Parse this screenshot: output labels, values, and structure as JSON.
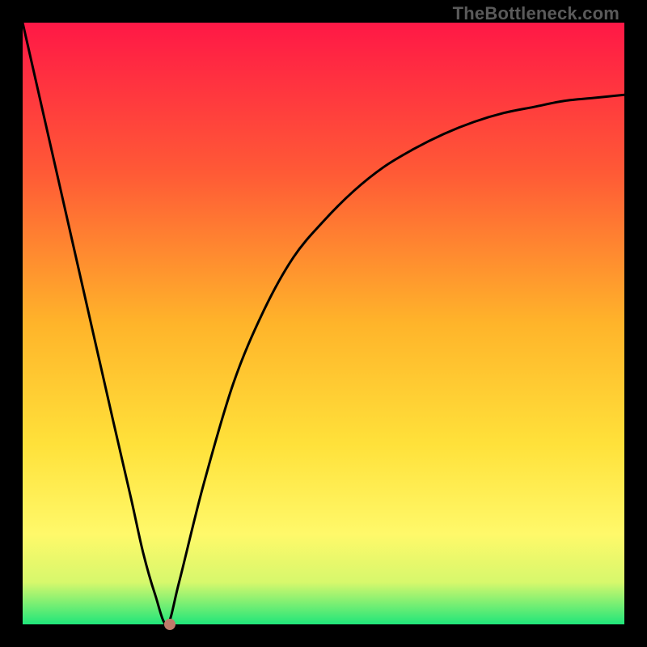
{
  "attribution": "TheBottleneck.com",
  "chart_data": {
    "type": "line",
    "title": "",
    "xlabel": "",
    "ylabel": "",
    "xlim": [
      0,
      100
    ],
    "ylim": [
      0,
      100
    ],
    "curve": {
      "name": "bottleneck-curve",
      "x": [
        0,
        5,
        10,
        15,
        18,
        20,
        22,
        24,
        26,
        30,
        35,
        40,
        45,
        50,
        55,
        60,
        65,
        70,
        75,
        80,
        85,
        90,
        95,
        100
      ],
      "y": [
        100,
        78,
        56,
        34,
        21,
        12,
        5,
        0,
        7,
        23,
        40,
        52,
        61,
        67,
        72,
        76,
        79,
        81.5,
        83.5,
        85,
        86,
        87,
        87.5,
        88
      ]
    },
    "marker": {
      "x": 24.5,
      "y": 0
    },
    "background_gradient": {
      "stops": [
        {
          "pos": 0.0,
          "color": "#ff1846"
        },
        {
          "pos": 0.25,
          "color": "#ff5a36"
        },
        {
          "pos": 0.5,
          "color": "#ffb42a"
        },
        {
          "pos": 0.7,
          "color": "#ffe13a"
        },
        {
          "pos": 0.85,
          "color": "#fff96a"
        },
        {
          "pos": 0.93,
          "color": "#d7f86c"
        },
        {
          "pos": 1.0,
          "color": "#20e67a"
        }
      ]
    }
  }
}
